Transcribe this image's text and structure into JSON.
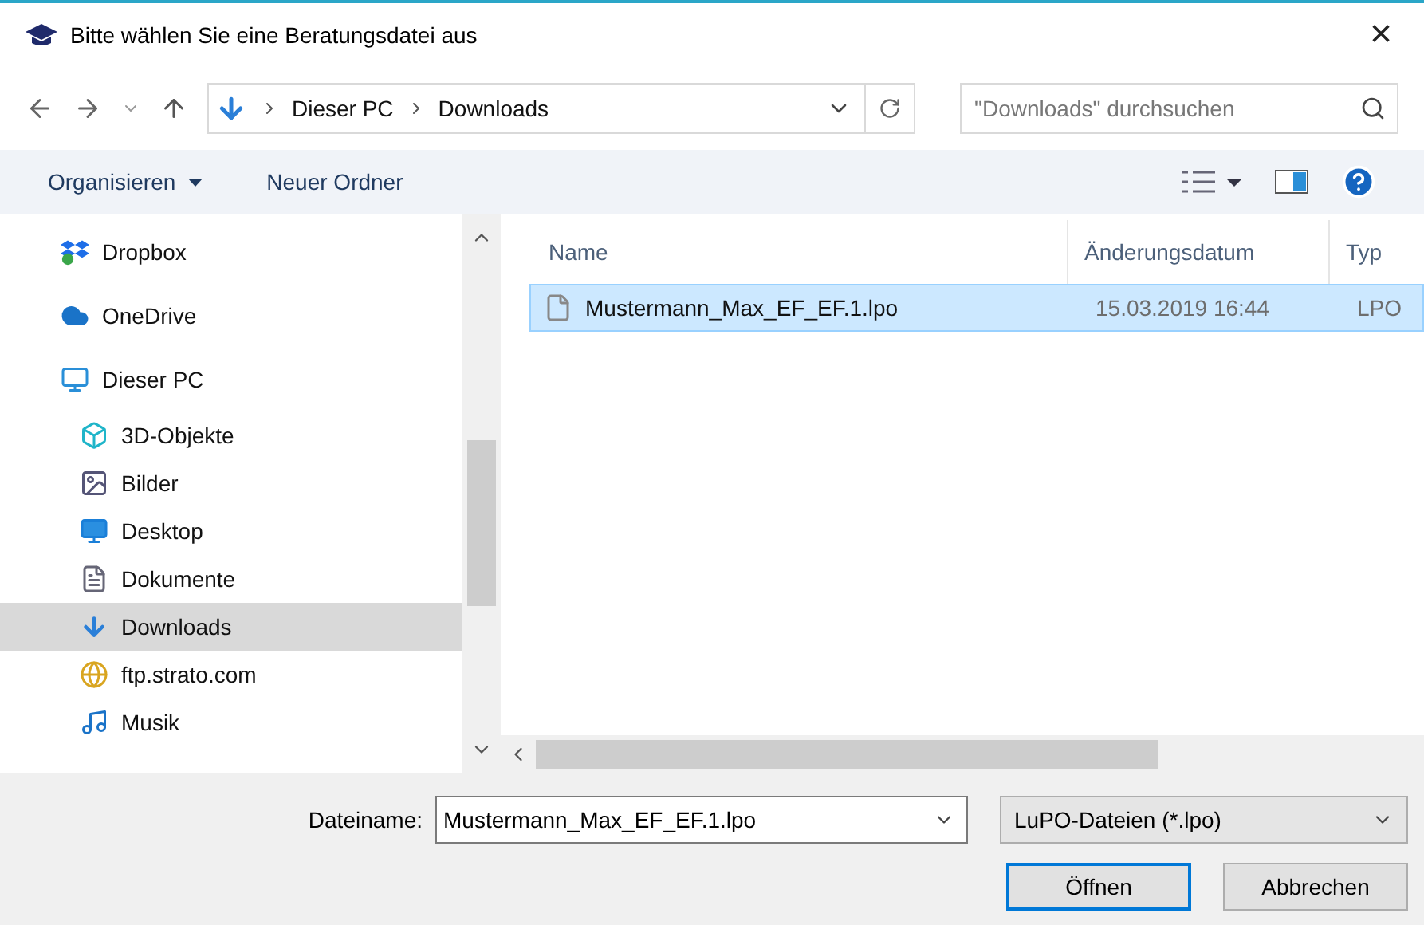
{
  "window": {
    "title": "Bitte wählen Sie eine Beratungsdatei aus",
    "close": "×"
  },
  "address": {
    "crumbs": [
      "Dieser PC",
      "Downloads"
    ],
    "search_placeholder": "\"Downloads\" durchsuchen"
  },
  "toolbar": {
    "organize": "Organisieren",
    "new_folder": "Neuer Ordner"
  },
  "sidebar": {
    "items": [
      {
        "label": "Dropbox",
        "selected": false
      },
      {
        "label": "OneDrive",
        "selected": false
      },
      {
        "label": "Dieser PC",
        "selected": false,
        "children": [
          {
            "label": "3D-Objekte",
            "selected": false
          },
          {
            "label": "Bilder",
            "selected": false
          },
          {
            "label": "Desktop",
            "selected": false
          },
          {
            "label": "Dokumente",
            "selected": false
          },
          {
            "label": "Downloads",
            "selected": true
          },
          {
            "label": "ftp.strato.com",
            "selected": false
          },
          {
            "label": "Musik",
            "selected": false
          }
        ]
      }
    ]
  },
  "table": {
    "columns": [
      "Name",
      "Änderungsdatum",
      "Typ"
    ],
    "rows": [
      {
        "name": "Mustermann_Max_EF_EF.1.lpo",
        "date": "15.03.2019 16:44",
        "type": "LPO",
        "selected": true
      }
    ]
  },
  "footer": {
    "filename_label": "Dateiname:",
    "filename": "Mustermann_Max_EF_EF.1.lpo",
    "filter": "LuPO-Dateien (*.lpo)",
    "open": "Öffnen",
    "cancel": "Abbrechen"
  }
}
